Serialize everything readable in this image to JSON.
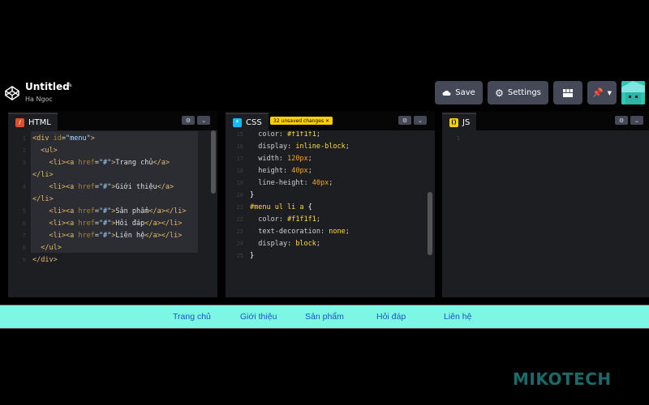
{
  "header": {
    "title": "Untitled",
    "author": "Ha Ngoc",
    "save_label": "Save",
    "settings_label": "Settings"
  },
  "panes": {
    "html": {
      "label": "HTML"
    },
    "css": {
      "label": "CSS",
      "unsaved": "32 unsaved changes"
    },
    "js": {
      "label": "JS"
    }
  },
  "html_code": {
    "lines": [
      {
        "num": "1",
        "text": "<div id=\"menu\">"
      },
      {
        "num": "2",
        "text": "<ul>"
      },
      {
        "num": "3",
        "text": "<li><a href=\"#\">Trang chủ</a>"
      },
      {
        "num": "",
        "text": "</li>"
      },
      {
        "num": "4",
        "text": "<li><a href=\"#\">Giới thiệu</a>"
      },
      {
        "num": "",
        "text": "</li>"
      },
      {
        "num": "5",
        "text": "<li><a href=\"#\">Sản phẩm</a></li>"
      },
      {
        "num": "6",
        "text": "<li><a href=\"#\">Hỏi đáp</a></li>"
      },
      {
        "num": "7",
        "text": "<li><a href=\"#\">Liên hệ</a></li>"
      },
      {
        "num": "8",
        "text": "</ul>"
      },
      {
        "num": "9",
        "text": "</div>"
      }
    ]
  },
  "css_code": {
    "lines": [
      {
        "num": "15",
        "text": "color: #f1f1f1;"
      },
      {
        "num": "16",
        "text": "display: inline-block;"
      },
      {
        "num": "17",
        "text": "width: 120px;"
      },
      {
        "num": "18",
        "text": "height: 40px;"
      },
      {
        "num": "19",
        "text": "line-height: 40px;"
      },
      {
        "num": "20",
        "text": "}"
      },
      {
        "num": "21",
        "text": "#menu ul li a {"
      },
      {
        "num": "22",
        "text": "color: #f1f1f1;"
      },
      {
        "num": "23",
        "text": "text-decoration: none;"
      },
      {
        "num": "24",
        "text": "display: block;"
      },
      {
        "num": "25",
        "text": "}"
      }
    ]
  },
  "js_code": {
    "lines": [
      {
        "num": "1",
        "text": ""
      }
    ]
  },
  "preview": {
    "menu": [
      "Trang chủ",
      "Giới thiệu",
      "Sản phẩm",
      "Hỏi đáp",
      "Liên hệ"
    ]
  },
  "watermark": "MIKOTECH",
  "colors": {
    "background": "#000000",
    "editor_bg": "#1d1e22",
    "button_bg": "#444857",
    "preview_bg": "#7cf7e3",
    "link": "#1d52c7",
    "unsaved_badge": "#fcd000",
    "html_badge": "#e44d26",
    "css_badge": "#0ebeff",
    "js_badge": "#fcd000"
  }
}
